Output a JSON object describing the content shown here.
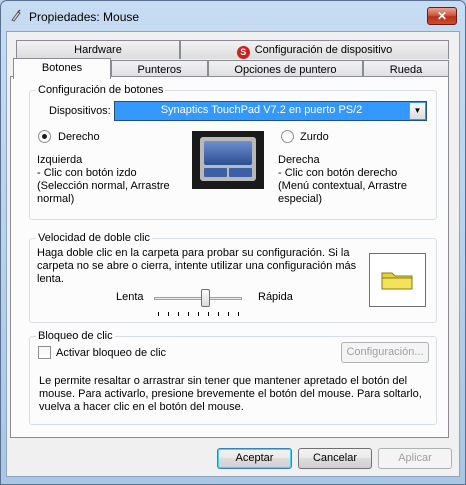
{
  "window": {
    "title": "Propiedades: Mouse",
    "close_label": "✕"
  },
  "tabs_top": [
    {
      "label": "Hardware"
    },
    {
      "label": "Configuración de dispositivo",
      "icon": "synaptics-icon"
    }
  ],
  "tabs_bottom": [
    {
      "label": "Botones",
      "active": true
    },
    {
      "label": "Punteros"
    },
    {
      "label": "Opciones de puntero"
    },
    {
      "label": "Rueda"
    }
  ],
  "button_config": {
    "group_label": "Configuración de botones",
    "devices_label": "Dispositivos:",
    "device_value": "Synaptics TouchPad V7.2 en puerto PS/2",
    "right_radio_label": "Derecho",
    "right_radio_selected": true,
    "left_radio_label": "Zurdo",
    "left_radio_selected": false,
    "left_col_title": "Izquierda",
    "left_col_line1": " - Clic con botón izdo",
    "left_col_line2": "(Selección normal, Arrastre normal)",
    "right_col_title": "Derecha",
    "right_col_line1": " - Clic con botón derecho",
    "right_col_line2": "(Menú contextual, Arrastre especial)"
  },
  "double_click": {
    "group_label": "Velocidad de doble clic",
    "description": "Haga doble clic en la carpeta para probar su configuración. Si la carpeta no se abre o cierra, intente utilizar una configuración más lenta.",
    "slow_label": "Lenta",
    "fast_label": "Rápida",
    "speed_fraction": 0.56
  },
  "click_lock": {
    "group_label": "Bloqueo de clic",
    "checkbox_label": "Activar bloqueo de clic",
    "checked": false,
    "settings_button": "Configuración...",
    "description": "Le permite resaltar o arrastrar sin tener que mantener apretado el botón del mouse. Para activarlo, presione brevemente el botón del mouse. Para soltarlo, vuelva a hacer clic en el botón del mouse."
  },
  "footer": {
    "ok": "Aceptar",
    "cancel": "Cancelar",
    "apply": "Aplicar"
  },
  "colors": {
    "selection": "#3399ff",
    "close_button": "#c7432a"
  }
}
